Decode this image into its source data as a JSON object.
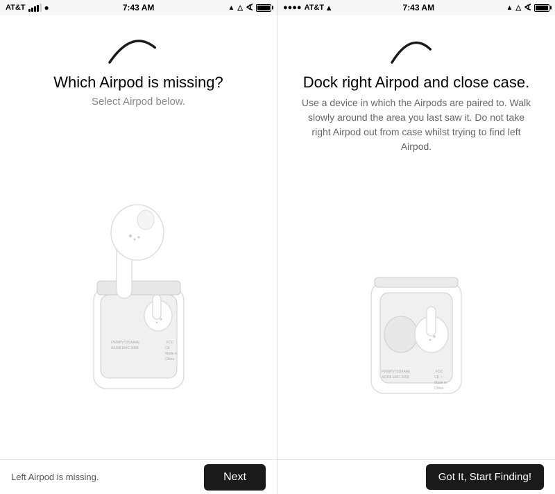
{
  "screen1": {
    "status": {
      "carrier": "AT&T",
      "time": "7:43 AM",
      "battery": "100%"
    },
    "title": "Which Airpod is missing?",
    "subtitle": "Select Airpod below.",
    "bottom_status": "Left Airpod is missing.",
    "next_button": "Next"
  },
  "screen2": {
    "status": {
      "carrier": "AT&T",
      "time": "7:43 AM",
      "battery": "100%"
    },
    "title": "Dock right Airpod and close case.",
    "description": "Use a device in which the Airpods are paired to. Walk slowly around the area you last saw it. Do not take right Airpod out from case whilst trying to find left Airpod.",
    "start_button": "Got It, Start Finding!"
  }
}
